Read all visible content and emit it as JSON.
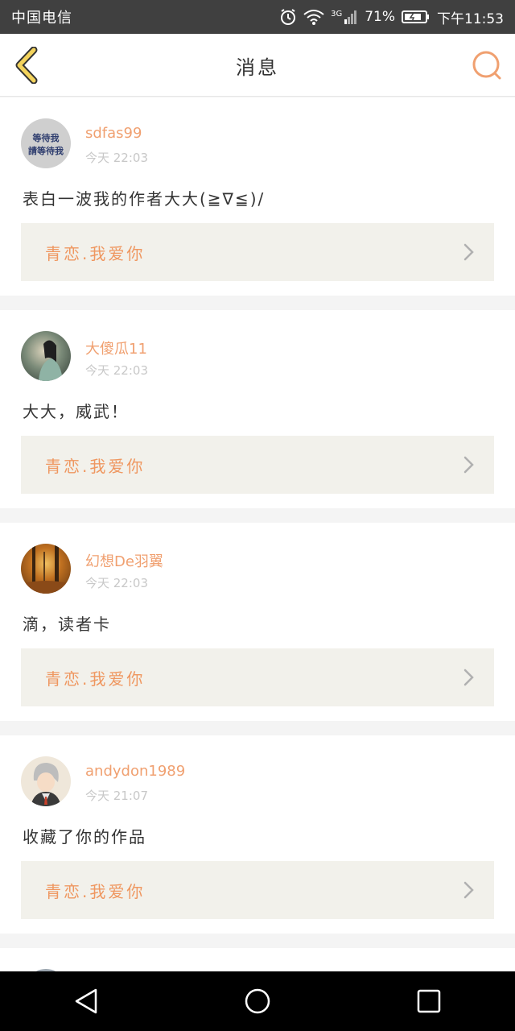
{
  "status_bar": {
    "carrier": "中国电信",
    "network": "3G",
    "battery": "71%",
    "time": "下午11:53"
  },
  "header": {
    "title": "消息"
  },
  "messages": [
    {
      "username": "sdfas99",
      "timestamp": "今天 22:03",
      "text": "表白一波我的作者大大(≧∇≦)/",
      "work_title": "青恋.我爱你",
      "avatar_text_1": "等待我",
      "avatar_text_2": "請等待我"
    },
    {
      "username": "大傻瓜11",
      "timestamp": "今天 22:03",
      "text": "大大，威武！",
      "work_title": "青恋.我爱你"
    },
    {
      "username": "幻想De羽翼",
      "timestamp": "今天 22:03",
      "text": "滴，读者卡",
      "work_title": "青恋.我爱你"
    },
    {
      "username": "andydon1989",
      "timestamp": "今天 21:07",
      "text": "收藏了你的作品",
      "work_title": "青恋.我爱你"
    }
  ],
  "colors": {
    "accent": "#ef9760",
    "status_bar": "#404040",
    "nav_bar": "#000000"
  }
}
